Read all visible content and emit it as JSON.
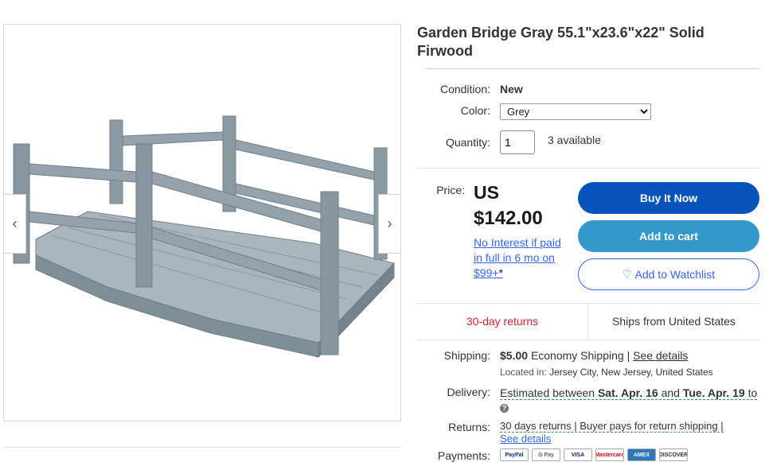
{
  "product": {
    "title": "Garden Bridge Gray 55.1\"x23.6\"x22\" Solid Firwood"
  },
  "gallery": {
    "prev_icon": "chevron-left-icon",
    "next_icon": "chevron-right-icon",
    "prev_glyph": "‹",
    "next_glyph": "›"
  },
  "condition": {
    "label": "Condition:",
    "value": "New"
  },
  "color": {
    "label": "Color:",
    "selected": "Grey"
  },
  "quantity": {
    "label": "Quantity:",
    "value": "1",
    "available": "3 available"
  },
  "price": {
    "label": "Price:",
    "currency": "US",
    "amount": "$142.00",
    "financing": "No Interest if paid in full in 6 mo on $99+",
    "financing_star": "*"
  },
  "buttons": {
    "buy_now": "Buy It Now",
    "add_to_cart": "Add to cart",
    "watchlist": "Add to Watchlist",
    "watch_icon": "♡"
  },
  "highlights": {
    "returns": "30-day returns",
    "ships_from": "Ships from United States"
  },
  "shipping": {
    "label": "Shipping:",
    "price": "$5.00",
    "method": "Economy Shipping |",
    "details_link": "See details",
    "located_label": "Located in:",
    "located_value": "Jersey City, New Jersey, United States"
  },
  "delivery": {
    "label": "Delivery:",
    "prefix": "Estimated between",
    "start": "Sat. Apr. 16",
    "and": "and",
    "end": "Tue. Apr. 19",
    "suffix": "to",
    "info_icon": "?"
  },
  "returns": {
    "label": "Returns:",
    "text": "30 days returns | Buyer pays for return shipping |",
    "details_link": "See details"
  },
  "payments": {
    "label": "Payments:",
    "methods": [
      "PayPal",
      "G Pay",
      "VISA",
      "Mastercard",
      "AMEX",
      "DISCOVER"
    ]
  },
  "colors": {
    "buy_now_bg": "#0654ba",
    "add_to_cart_bg": "#3498ca",
    "link": "#3665f3",
    "returns_red": "#dd1e31"
  }
}
